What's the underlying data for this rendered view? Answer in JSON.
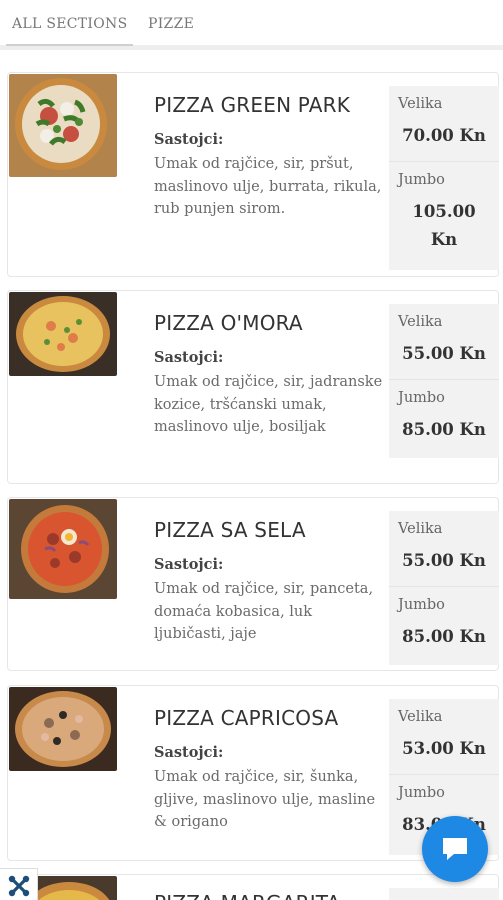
{
  "tabs": [
    {
      "label": "ALL SECTIONS",
      "active": true
    },
    {
      "label": "PIZZE",
      "active": false
    }
  ],
  "ingredients_label": "Sastojci:",
  "items": [
    {
      "name": "PIZZA GREEN PARK",
      "ingredients": "Umak od rajčice, sir, pršut, maslinovo ulje, burrata, rikula, rub punjen sirom.",
      "sizes": [
        {
          "label": "Velika",
          "price": "70.00 Kn"
        },
        {
          "label": "Jumbo",
          "price": "105.00 Kn"
        }
      ]
    },
    {
      "name": "PIZZA O'MORA",
      "ingredients": "Umak od rajčice, sir, jadranske kozice, tršćanski umak, maslinovo ulje, bosiljak",
      "sizes": [
        {
          "label": "Velika",
          "price": "55.00 Kn"
        },
        {
          "label": "Jumbo",
          "price": "85.00 Kn"
        }
      ]
    },
    {
      "name": "PIZZA SA SELA",
      "ingredients": "Umak od rajčice, sir, panceta, domaća kobasica, luk ljubičasti, jaje",
      "sizes": [
        {
          "label": "Velika",
          "price": "55.00 Kn"
        },
        {
          "label": "Jumbo",
          "price": "85.00 Kn"
        }
      ]
    },
    {
      "name": "PIZZA CAPRICOSA",
      "ingredients": "Umak od rajčice, sir, šunka, gljive, maslinovo ulje, masline & origano",
      "sizes": [
        {
          "label": "Velika",
          "price": "53.00 Kn"
        },
        {
          "label": "Jumbo",
          "price": "83.00 Kn"
        }
      ]
    },
    {
      "name": "PIZZA MARGARITA"
    }
  ],
  "icons": {
    "chat": "chat-bubble-icon",
    "corner": "joomla-logo-icon"
  },
  "colors": {
    "accent": "#1e88e5",
    "price_bg": "#f2f2f2"
  }
}
